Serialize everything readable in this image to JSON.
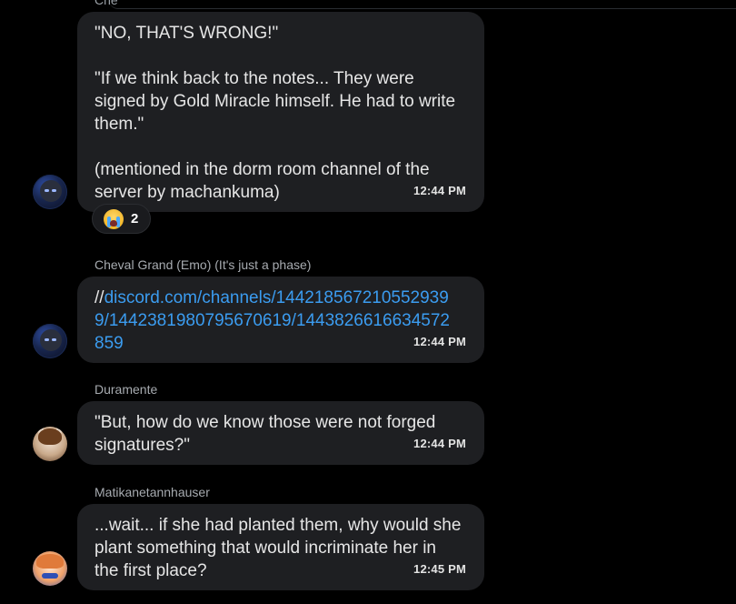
{
  "clipped_author": "Che",
  "messages": [
    {
      "author": "",
      "lines": [
        "\"NO, THAT'S WRONG!\"",
        "",
        "\"If we think back to the notes... They were",
        "signed by Gold Miracle himself. He had to write",
        "them.\"",
        "",
        "(mentioned in the dorm room channel of the",
        "server by machankuma)"
      ],
      "time": "12:44 PM",
      "reaction": {
        "emoji": "crying-face",
        "count": "2"
      }
    },
    {
      "author": "Cheval Grand (Emo) (It's just a phase)",
      "link_prefix": "//",
      "link_lines": [
        "discord.com/channels/144218567210552939",
        "9/1442381980795670619/1443826616634572",
        "859"
      ],
      "time": "12:44 PM"
    },
    {
      "author": "Duramente",
      "lines": [
        "\"But, how do we know those were not forged",
        "signatures?\""
      ],
      "time": "12:44 PM"
    },
    {
      "author": "Matikanetannhauser",
      "lines": [
        "...wait... if she had planted them, why would she",
        "plant something that would incriminate her in",
        "the first place?"
      ],
      "time": "12:45 PM"
    }
  ],
  "colors": {
    "background": "#000000",
    "bubble": "#1e1f22",
    "link": "#3b9cf0",
    "text": "#e6e6e6",
    "author": "#a7abb0"
  }
}
